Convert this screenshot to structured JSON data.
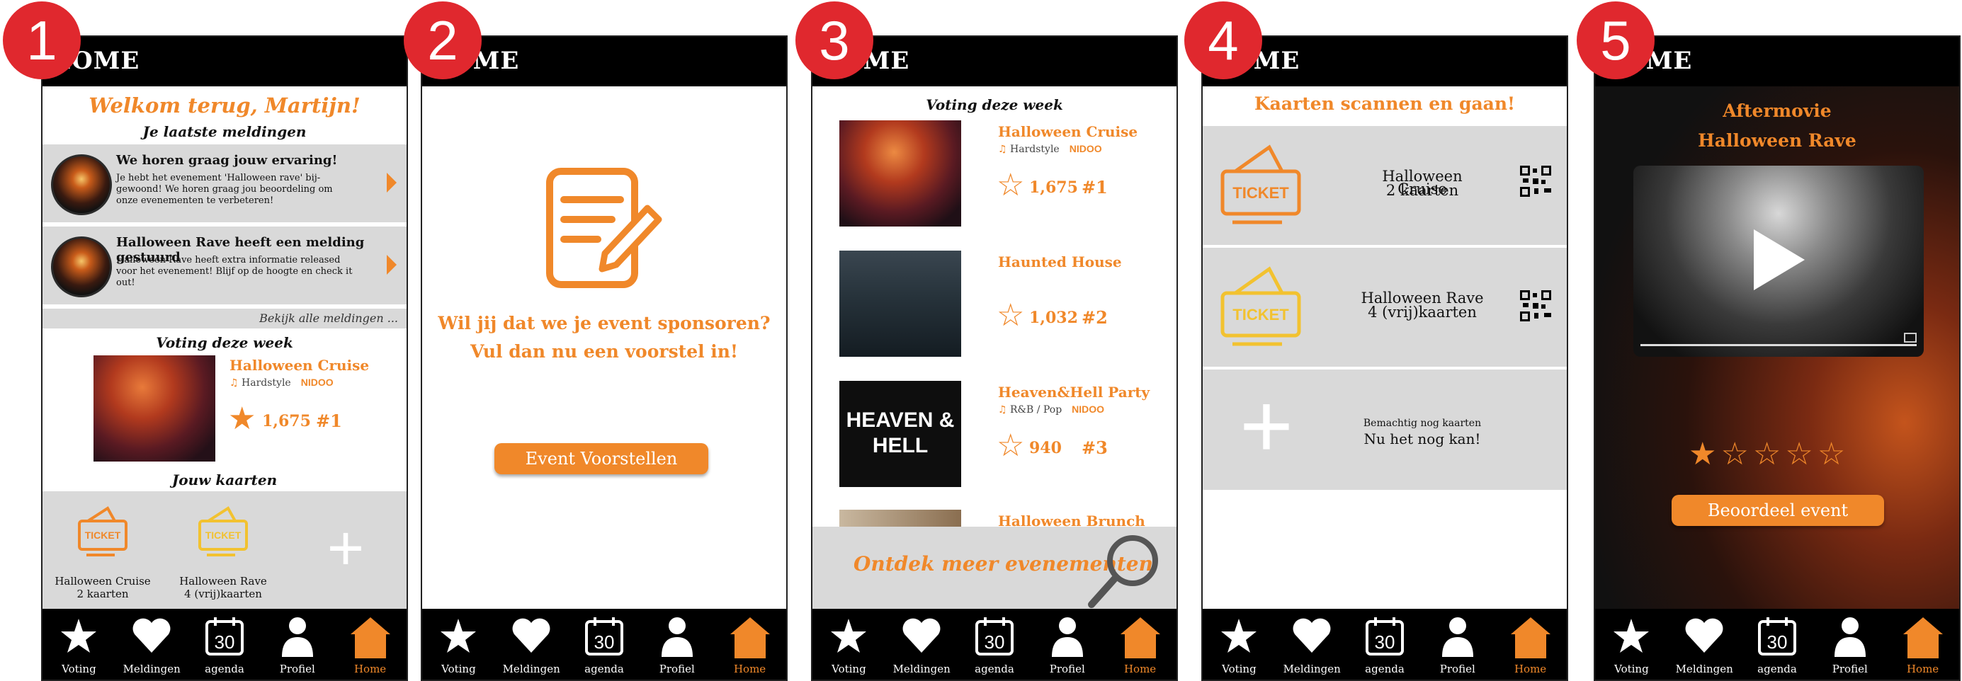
{
  "colors": {
    "accent": "#f0882a",
    "badge": "#e0282e",
    "header": "#000000",
    "panel": "#d9d9d9",
    "ticket_yellow": "#f2c230"
  },
  "header_title": "HOME",
  "nav": [
    {
      "label": "Voting",
      "icon": "star-icon"
    },
    {
      "label": "Meldingen",
      "icon": "heart-icon"
    },
    {
      "label": "agenda",
      "icon": "calendar-icon",
      "day": "30"
    },
    {
      "label": "Profiel",
      "icon": "person-icon"
    },
    {
      "label": "Home",
      "icon": "home-icon",
      "active": true
    }
  ],
  "badges": [
    "1",
    "2",
    "3",
    "4",
    "5"
  ],
  "screen1": {
    "welcome": "Welkom terug, Martijn!",
    "notifications_heading": "Je laatste meldingen",
    "notifications": [
      {
        "title": "We horen graag jouw ervaring!",
        "body": "Je hebt het evenement 'Halloween rave' bij-gewoond! We horen graag jou beoordeling om onze evenementen te verbeteren!"
      },
      {
        "title": "Halloween Rave heeft een melding gestuurd",
        "body": "Halloween Rave heeft extra informatie released voor het evenement! Blijf op de hoogte en check it out!"
      }
    ],
    "view_all": "Bekijk alle meldingen ...",
    "voting_heading": "Voting deze week",
    "event": {
      "title": "Halloween Cruise",
      "genre": "Hardstyle",
      "org": "NIDOO",
      "score": "1,675",
      "rank": "#1"
    },
    "cards_heading": "Jouw kaarten",
    "cards": [
      {
        "name": "Halloween Cruise",
        "count": "2 kaarten",
        "ticket_text": "TICKET"
      },
      {
        "name": "Halloween Rave",
        "count": "4 (vrij)kaarten",
        "ticket_text": "TICKET"
      }
    ],
    "add_symbol": "+"
  },
  "screen2": {
    "line1": "Wil jij dat we je event sponsoren?",
    "line2": "Vul dan nu een voorstel in!",
    "button": "Event Voorstellen"
  },
  "screen3": {
    "heading": "Voting deze week",
    "events": [
      {
        "title": "Halloween Cruise",
        "genre": "Hardstyle",
        "org": "NIDOO",
        "score": "1,675",
        "rank": "#1"
      },
      {
        "title": "Haunted House",
        "genre": "",
        "org": "",
        "score": "1,032",
        "rank": "#2"
      },
      {
        "title": "Heaven&Hell Party",
        "genre": "R&B / Pop",
        "org": "NIDOO",
        "score": "940",
        "rank": "#3",
        "image_text": "HEAVEN & HELL"
      },
      {
        "title": "Halloween Brunch"
      }
    ],
    "discover": "Ontdek meer evenementen"
  },
  "screen4": {
    "heading": "Kaarten scannen en gaan!",
    "cards": [
      {
        "name": "Halloween Cruise",
        "count": "2 kaarten",
        "ticket_text": "TICKET"
      },
      {
        "name": "Halloween Rave",
        "count": "4 (vrij)kaarten",
        "ticket_text": "TICKET"
      }
    ],
    "add_small": "Bemachtig nog kaarten",
    "add_big": "Nu het nog kan!",
    "add_symbol": "+"
  },
  "screen5": {
    "title1": "Aftermovie",
    "title2": "Halloween Rave",
    "rating": 1,
    "max_rating": 5,
    "button": "Beoordeel event"
  }
}
